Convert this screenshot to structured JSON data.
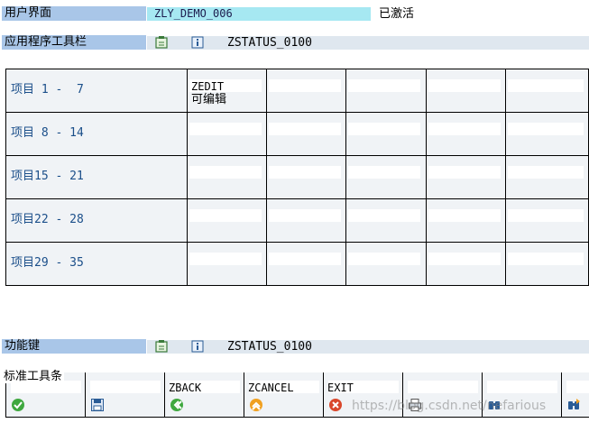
{
  "header": {
    "user_interface_label": "用户界面",
    "program_value": "ZLY_DEMO_006",
    "status_text": "已激活"
  },
  "app_toolbar": {
    "label": "应用程序工具栏",
    "status_name": "ZSTATUS_0100"
  },
  "grid": {
    "rows": [
      {
        "label": "项目",
        "range": " 1 -  7"
      },
      {
        "label": "项目",
        "range": " 8 - 14"
      },
      {
        "label": "项目",
        "range": "15 - 21"
      },
      {
        "label": "项目",
        "range": "22 - 28"
      },
      {
        "label": "项目",
        "range": "29 - 35"
      }
    ],
    "first_cell": {
      "code": "ZEDIT",
      "text": "可编辑"
    }
  },
  "function_keys": {
    "label": "功能键",
    "status_name": "ZSTATUS_0100"
  },
  "std_toolbar": {
    "label": "标准工具条",
    "buttons": [
      {
        "code": "",
        "icon": "check-icon"
      },
      {
        "code": "",
        "icon": "save-icon"
      },
      {
        "code": "ZBACK",
        "icon": "back-icon"
      },
      {
        "code": "ZCANCEL",
        "icon": "cancel-icon"
      },
      {
        "code": "EXIT",
        "icon": "exit-icon"
      },
      {
        "code": "",
        "icon": "print-icon"
      },
      {
        "code": "",
        "icon": "find-icon"
      },
      {
        "code": "",
        "icon": "find-next-icon"
      }
    ]
  },
  "watermark": "https://blog.csdn.net/nefarious"
}
